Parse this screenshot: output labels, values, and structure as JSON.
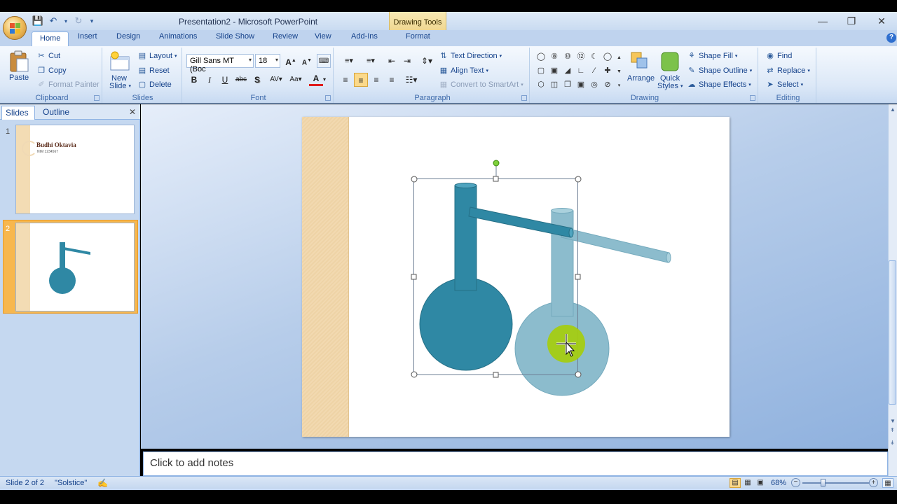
{
  "window": {
    "title": "Presentation2 - Microsoft PowerPoint",
    "contextual_tab_group": "Drawing Tools"
  },
  "tabs": [
    "Home",
    "Insert",
    "Design",
    "Animations",
    "Slide Show",
    "Review",
    "View",
    "Add-Ins",
    "Format"
  ],
  "active_tab": "Home",
  "ribbon": {
    "clipboard": {
      "label": "Clipboard",
      "paste": "Paste",
      "cut": "Cut",
      "copy": "Copy",
      "format_painter": "Format Painter"
    },
    "slides": {
      "label": "Slides",
      "new_slide_1": "New",
      "new_slide_2": "Slide",
      "layout": "Layout",
      "reset": "Reset",
      "delete": "Delete"
    },
    "font": {
      "label": "Font",
      "font_name": "Gill Sans MT (Boc",
      "font_size": "18"
    },
    "paragraph": {
      "label": "Paragraph",
      "text_direction": "Text Direction",
      "align_text": "Align Text",
      "convert_smartart": "Convert to SmartArt"
    },
    "drawing": {
      "label": "Drawing",
      "arrange": "Arrange",
      "quick_styles_1": "Quick",
      "quick_styles_2": "Styles",
      "shape_fill": "Shape Fill",
      "shape_outline": "Shape Outline",
      "shape_effects": "Shape Effects"
    },
    "editing": {
      "label": "Editing",
      "find": "Find",
      "replace": "Replace",
      "select": "Select"
    }
  },
  "left_pane": {
    "tab_slides": "Slides",
    "tab_outline": "Outline",
    "thumbnails": [
      {
        "number": "1",
        "title": "Budhi Oktavia",
        "subtitle": "NIM 1234567"
      },
      {
        "number": "2"
      }
    ]
  },
  "notes_placeholder": "Click to add notes",
  "status": {
    "slide_info": "Slide 2 of 2",
    "theme": "\"Solstice\"",
    "zoom": "68%"
  },
  "colors": {
    "flask_front": "#2f88a4",
    "flask_ghost": "#86b9cb",
    "cursor_highlight": "#a4cc12",
    "theme_stripe": "#f3dcb4"
  }
}
